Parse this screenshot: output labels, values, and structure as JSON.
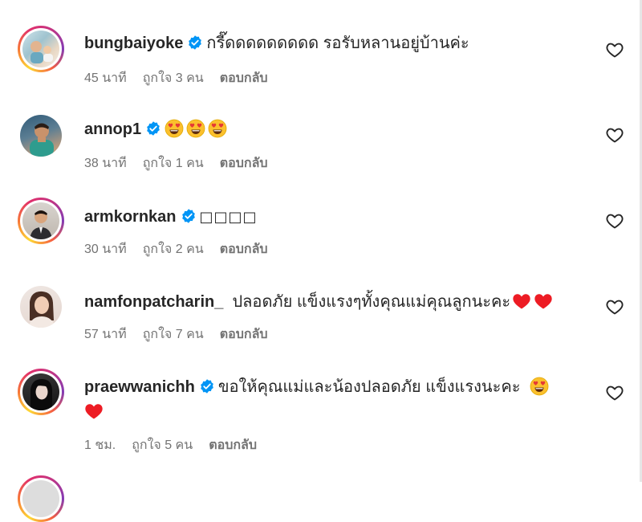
{
  "comments": [
    {
      "username": "bungbaiyoke",
      "verified": true,
      "text": "กรี๊ดดดดดดดดด รอรับหลานอยู่บ้านค่ะ",
      "emoji_count": 0,
      "time": "45 นาที",
      "likes": "ถูกใจ 3 คน",
      "reply": "ตอบกลับ",
      "avatar_ring": true
    },
    {
      "username": "annop1",
      "verified": true,
      "text": "",
      "emoji_count": 3,
      "emoji_name": "heart-eyes-emoji",
      "time": "38 นาที",
      "likes": "ถูกใจ 1 คน",
      "reply": "ตอบกลับ",
      "avatar_ring": false
    },
    {
      "username": "armkornkan",
      "verified": true,
      "text": "□□□□",
      "emoji_count": 0,
      "time": "30 นาที",
      "likes": "ถูกใจ 2 คน",
      "reply": "ตอบกลับ",
      "avatar_ring": true
    },
    {
      "username": "namfonpatcharin_",
      "verified": false,
      "text": "ปลอดภัย แข็งแรงๆทั้งคุณแม่คุณลูกนะคะ",
      "hearts": 2,
      "time": "57 นาที",
      "likes": "ถูกใจ 7 คน",
      "reply": "ตอบกลับ",
      "avatar_ring": false
    },
    {
      "username": "praewwanichh",
      "verified": true,
      "text": "ขอให้คุณแม่และน้องปลอดภัย แข็งแรงนะคะ",
      "time": "1 ชม.",
      "likes": "ถูกใจ 5 คน",
      "reply": "ตอบกลับ",
      "avatar_ring": true
    }
  ],
  "colors": {
    "verified": "#0095f6",
    "meta": "#737373",
    "heart_red": "#ed1c24",
    "emoji_yellow": "#fbc02d"
  }
}
